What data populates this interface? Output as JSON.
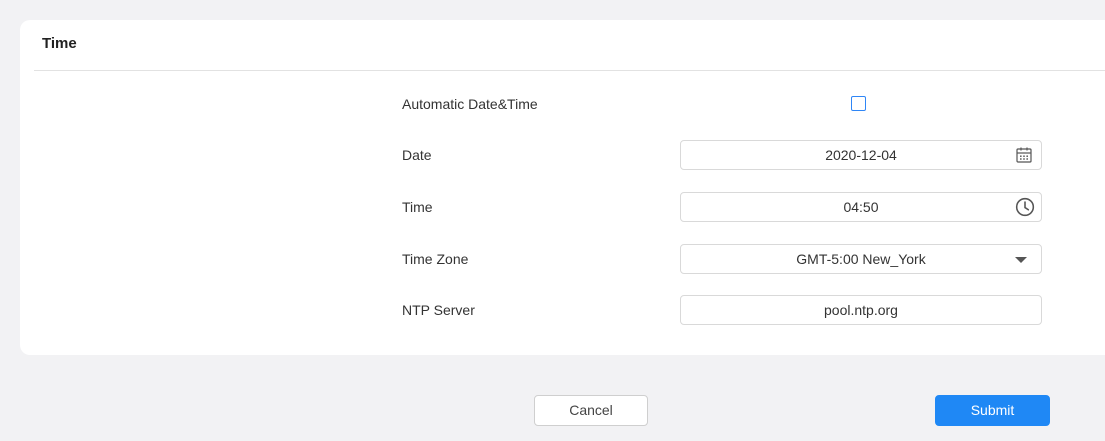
{
  "section": {
    "title": "Time"
  },
  "settings": {
    "auto_label": "Automatic Date&Time",
    "auto_checked": false,
    "date_label": "Date",
    "date_value": "2020-12-04",
    "time_label": "Time",
    "time_value": "04:50",
    "timezone_label": "Time Zone",
    "timezone_value": "GMT-5:00 New_York",
    "ntp_label": "NTP Server",
    "ntp_value": "pool.ntp.org"
  },
  "icons": {
    "date": "calendar-icon",
    "time": "clock-icon",
    "timezone": "chevron-down-icon"
  },
  "actions": {
    "cancel": "Cancel",
    "submit": "Submit"
  },
  "colors": {
    "accent": "#1f88f5",
    "background": "#f2f2f4",
    "card": "#ffffff"
  }
}
